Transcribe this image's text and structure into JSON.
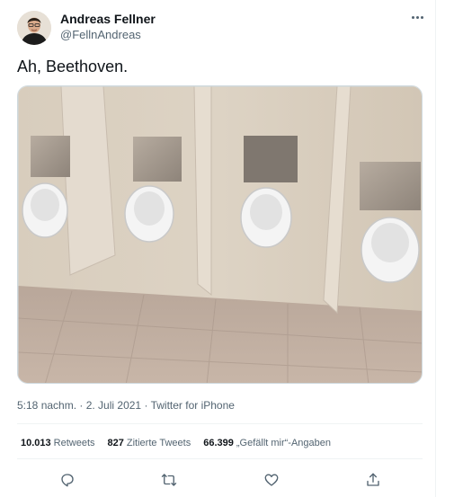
{
  "author": {
    "name": "Andreas Fellner",
    "handle": "@FellnAndreas"
  },
  "tweet": {
    "text": "Ah, Beethoven.",
    "time": "5:18 nachm.",
    "date": "2. Juli 2021",
    "source": "Twitter for iPhone",
    "separator": " · "
  },
  "stats": {
    "retweets_count": "10.013",
    "retweets_label": "Retweets",
    "quotes_count": "827",
    "quotes_label": "Zitierte Tweets",
    "likes_count": "66.399",
    "likes_label": "„Gefällt mir“-Angaben"
  },
  "icons": {
    "more": "more-icon",
    "reply": "reply-icon",
    "retweet": "retweet-icon",
    "like": "like-icon",
    "share": "share-icon"
  },
  "colors": {
    "secondary_text": "#536471",
    "divider": "#eff3f4"
  }
}
